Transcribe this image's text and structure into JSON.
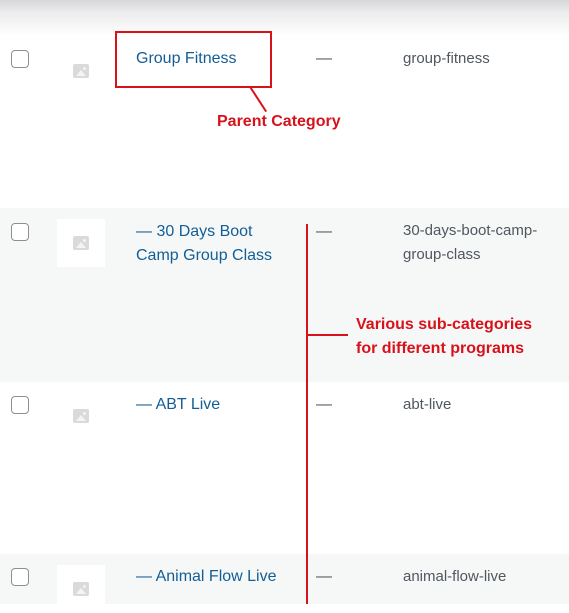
{
  "rows": [
    {
      "name": "Group Fitness",
      "parent": "—",
      "slug": "group-fitness"
    },
    {
      "name_line1": "— 30 Days Boot",
      "name_line2": "Camp Group Class",
      "parent": "—",
      "slug_line1": "30-days-boot-camp-",
      "slug_line2": "group-class"
    },
    {
      "name": "— ABT Live",
      "parent": "—",
      "slug": "abt-live"
    },
    {
      "name": "— Animal Flow Live",
      "parent": "—",
      "slug": "animal-flow-live"
    }
  ],
  "annotations": {
    "parent_category": "Parent Category",
    "subcategories_line1": "Various sub-categories",
    "subcategories_line2": "for different programs",
    "color": "#d8121b"
  },
  "colors": {
    "link": "#135e96",
    "text": "#50575e",
    "row_alt": "#f6f7f7"
  },
  "icons": {
    "thumbnail": "image-placeholder-icon"
  }
}
